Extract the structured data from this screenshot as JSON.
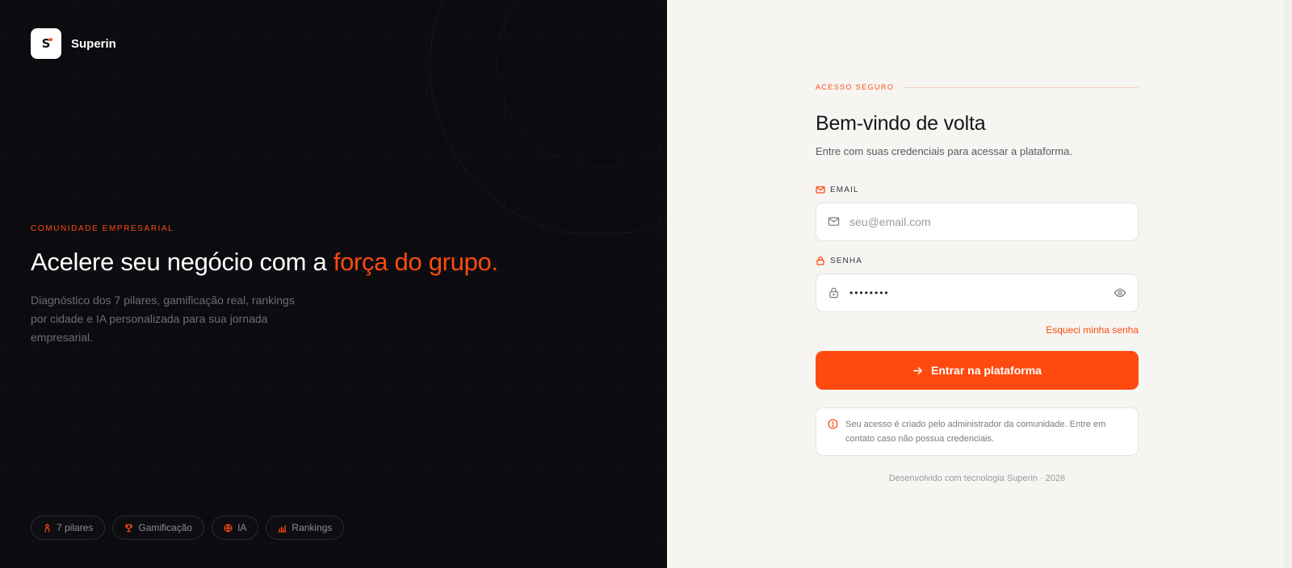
{
  "brand": {
    "mark": "S",
    "name": "Superin"
  },
  "hero": {
    "eyebrow": "COMUNIDADE EMPRESARIAL",
    "headline": "Acelere seu negócio com a",
    "headline_accent": "força do grupo.",
    "description": "Diagnóstico dos 7 pilares, gamificação real, rankings por cidade e IA personalizada para sua jornada empresarial."
  },
  "chips": [
    {
      "label": "7 pilares",
      "icon": "figure-icon"
    },
    {
      "label": "Gamificação",
      "icon": "trophy-icon"
    },
    {
      "label": "IA",
      "icon": "globe-icon"
    },
    {
      "label": "Rankings",
      "icon": "bar-chart-icon"
    }
  ],
  "login": {
    "secure_label": "ACESSO SEGURO",
    "title": "Bem-vindo de volta",
    "subtitle": "Entre com suas credenciais para acessar a plataforma.",
    "email_label": "EMAIL",
    "email_placeholder": "seu@email.com",
    "password_label": "SENHA",
    "password_value": "••••••••",
    "forgot_link": "Esqueci minha senha",
    "submit_label": "Entrar na plataforma",
    "notice": "Seu acesso é criado pelo administrador da comunidade. Entre em contato caso não possua credenciais.",
    "footer": "Desenvolvido com tecnologia Superin · 2026"
  },
  "colors": {
    "accent": "#ff4a0f",
    "left_bg": "#0c0c10",
    "right_bg": "#f6f5f2"
  }
}
